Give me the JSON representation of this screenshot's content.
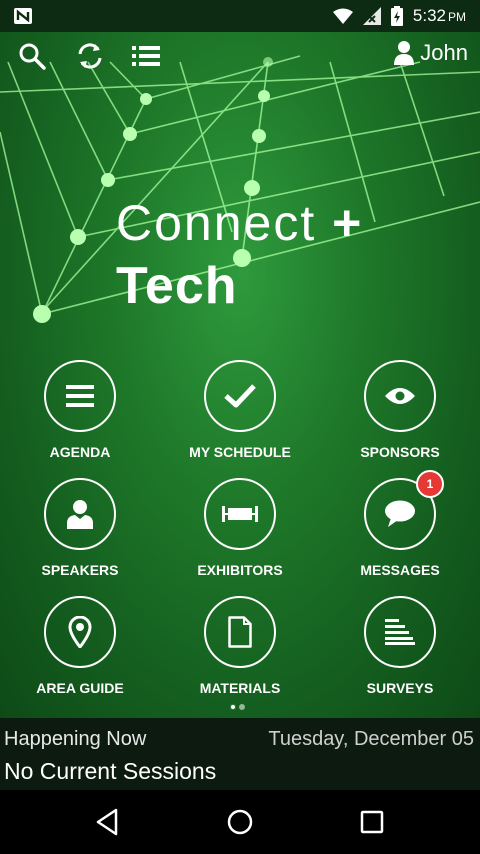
{
  "status_bar": {
    "time": "5:32",
    "ampm": "PM"
  },
  "toolbar": {
    "user_name": "John"
  },
  "logo": {
    "line1": "Connect",
    "plus": "+",
    "line2": "Tech"
  },
  "tiles": [
    {
      "label": "AGENDA",
      "icon": "list-lines-icon"
    },
    {
      "label": "MY SCHEDULE",
      "icon": "checkmark-icon"
    },
    {
      "label": "SPONSORS",
      "icon": "eye-icon"
    },
    {
      "label": "SPEAKERS",
      "icon": "person-icon"
    },
    {
      "label": "EXHIBITORS",
      "icon": "banner-icon"
    },
    {
      "label": "MESSAGES",
      "icon": "chat-bubble-icon",
      "badge": "1"
    },
    {
      "label": "AREA GUIDE",
      "icon": "map-pin-icon"
    },
    {
      "label": "MATERIALS",
      "icon": "document-icon"
    },
    {
      "label": "SURVEYS",
      "icon": "survey-lines-icon"
    }
  ],
  "happening": {
    "title": "Happening Now",
    "date": "Tuesday, December 05",
    "sessions": "No Current Sessions"
  },
  "colors": {
    "accent_green": "#1f7a2a",
    "badge_red": "#e53935",
    "line_glow": "#9dff9a"
  }
}
